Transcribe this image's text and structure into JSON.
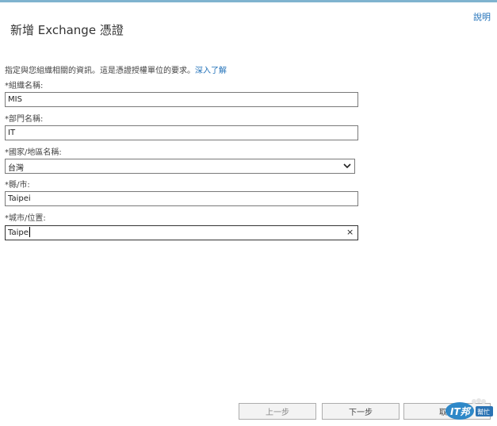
{
  "header": {
    "help_link": "說明",
    "title": "新增 Exchange 憑證"
  },
  "form": {
    "intro_text": "指定與您組織相關的資訊。這是憑證授權單位的要求。",
    "learn_more": "深入了解",
    "organization": {
      "label": "*組織名稱:",
      "value": "MIS"
    },
    "department": {
      "label": "*部門名稱:",
      "value": "IT"
    },
    "country": {
      "label": "*國家/地區名稱:",
      "value": "台灣"
    },
    "state": {
      "label": "*縣/市:",
      "value": "Taipei"
    },
    "city": {
      "label": "*城市/位置:",
      "value": "Taipei",
      "clear": "×"
    }
  },
  "footer": {
    "back": "上一步",
    "next": "下一步",
    "cancel": "取消"
  },
  "watermark": {
    "logo_text": "IT邦",
    "badge_text": "幫忙"
  },
  "colors": {
    "link": "#1e6fb8",
    "accent_rule": "#7fb3cf"
  }
}
